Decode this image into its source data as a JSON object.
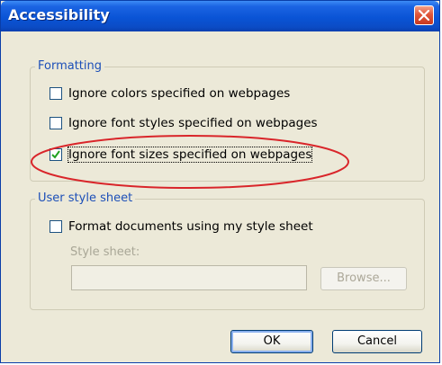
{
  "window": {
    "title": "Accessibility"
  },
  "formatting": {
    "group_label": "Formatting",
    "options": [
      {
        "label": "Ignore colors specified on webpages",
        "checked": false
      },
      {
        "label": "Ignore font styles specified on webpages",
        "checked": false
      },
      {
        "label": "Ignore font sizes specified on webpages",
        "checked": true
      }
    ]
  },
  "style_sheet": {
    "group_label": "User style sheet",
    "format_label": "Format documents using my style sheet",
    "format_checked": false,
    "field_label": "Style sheet:",
    "field_value": "",
    "browse_label": "Browse..."
  },
  "footer": {
    "ok_label": "OK",
    "cancel_label": "Cancel"
  },
  "icons": {
    "close": "close-icon",
    "checkmark": "checkmark-icon"
  },
  "colors": {
    "titlebar": "#0a54d6",
    "group_label": "#1c4fb8",
    "highlight_ellipse": "#d9252a"
  }
}
